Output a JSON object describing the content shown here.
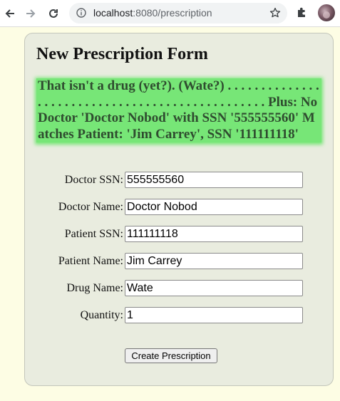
{
  "browser": {
    "url_host": "localhost",
    "url_rest": ":8080/prescription"
  },
  "form": {
    "title": "New Prescription Form",
    "message": "That isn't a drug (yet?). (Wate?) . . . . . . . . . . . . . . . . . . . . . . . . . . . . . . . . . . . . . . . . . . . . . . . . Plus: No Doctor 'Doctor Nobod' with SSN '555555560' Matches Patient: 'Jim Carrey', SSN '111111118'",
    "fields": [
      {
        "label": "Doctor SSN:",
        "value": "555555560"
      },
      {
        "label": "Doctor Name:",
        "value": "Doctor Nobod"
      },
      {
        "label": "Patient SSN:",
        "value": "111111118"
      },
      {
        "label": "Patient Name:",
        "value": "Jim Carrey"
      },
      {
        "label": "Drug Name:",
        "value": "Wate"
      },
      {
        "label": "Quantity:",
        "value": "1"
      }
    ],
    "submit_label": "Create Prescription"
  }
}
